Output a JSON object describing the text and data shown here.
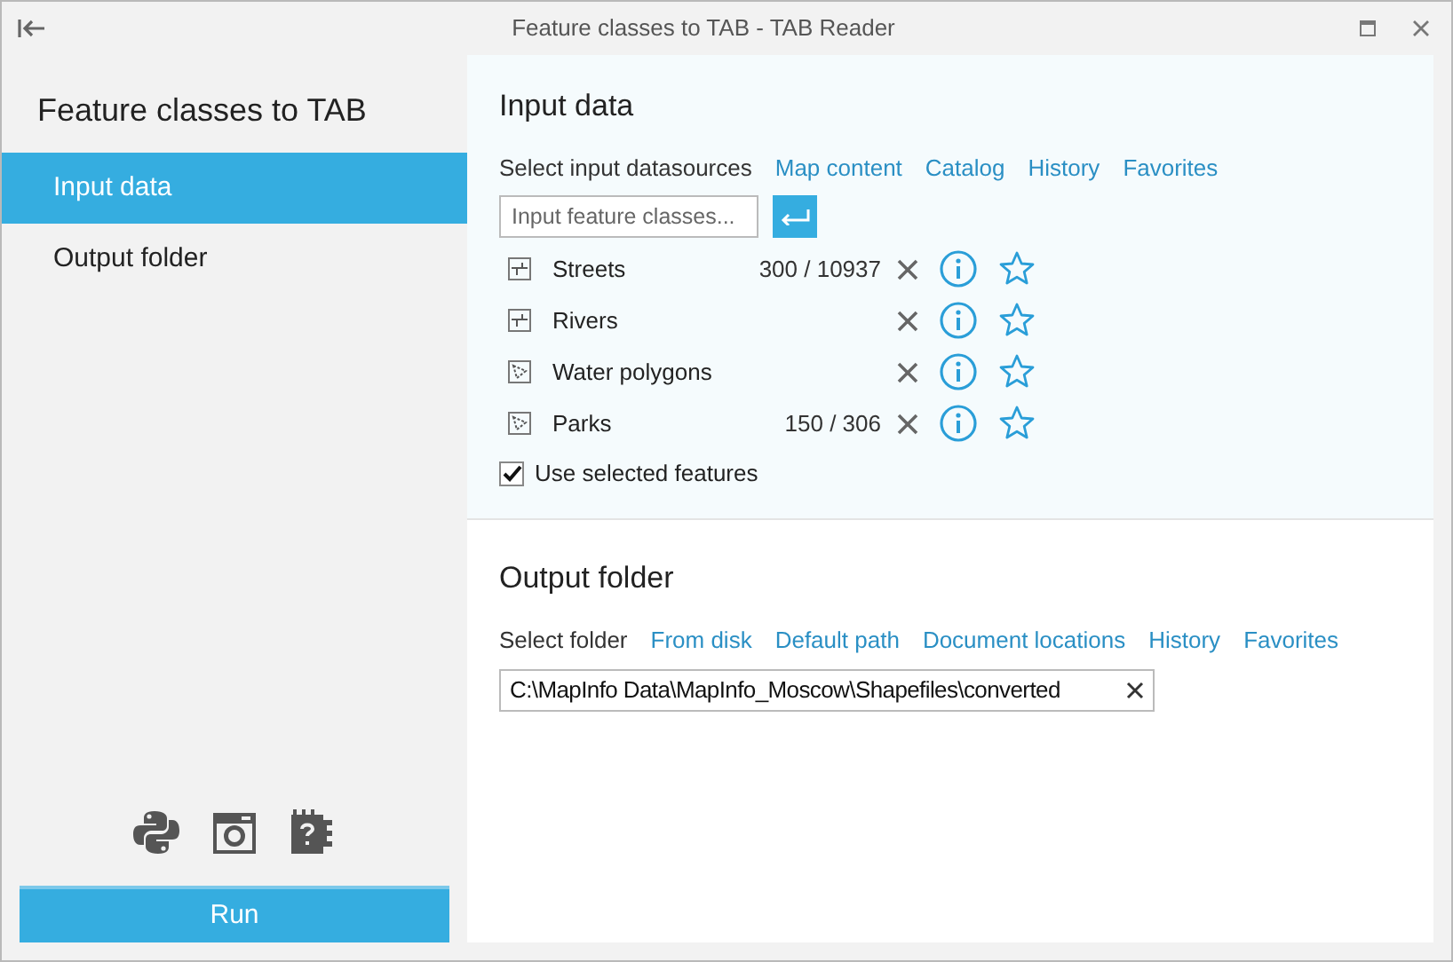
{
  "window": {
    "title": "Feature classes to TAB - TAB Reader"
  },
  "sidebar": {
    "title": "Feature classes to TAB",
    "items": [
      {
        "label": "Input data",
        "selected": true
      },
      {
        "label": "Output folder",
        "selected": false
      }
    ],
    "run_button": "Run"
  },
  "input_data": {
    "title": "Input data",
    "source_label": "Select input datasources",
    "links": [
      "Map content",
      "Catalog",
      "History",
      "Favorites"
    ],
    "search": {
      "placeholder": "Input feature classes..."
    },
    "layers": [
      {
        "name": "Streets",
        "kind": "line",
        "count": "300 / 10937"
      },
      {
        "name": "Rivers",
        "kind": "line"
      },
      {
        "name": "Water polygons",
        "kind": "polygon"
      },
      {
        "name": "Parks",
        "kind": "polygon",
        "count": "150 / 306"
      }
    ],
    "use_selected": {
      "label": "Use selected features",
      "checked": true
    }
  },
  "output_folder": {
    "title": "Output folder",
    "source_label": "Select folder",
    "links": [
      "From disk",
      "Default path",
      "Document locations",
      "History",
      "Favorites"
    ],
    "path": "C:\\MapInfo Data\\MapInfo_Moscow\\Shapefiles\\converted"
  }
}
